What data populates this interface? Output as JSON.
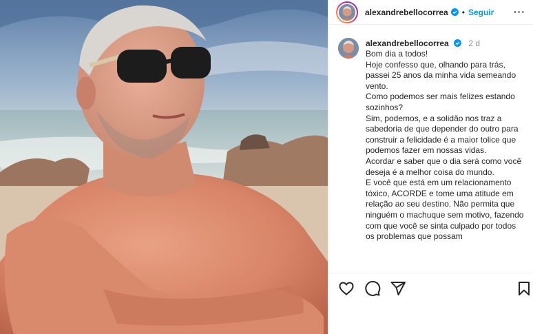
{
  "post": {
    "username": "alexandrebellocorrea",
    "follow_label": "Seguir",
    "separator": "•",
    "more_label": "···",
    "caption_username": "alexandrebellocorrea",
    "caption_time": "2 d",
    "caption_text": "Bom dia a todos!\nHoje confesso que, olhando para trás, passei 25 anos da minha vida semeando vento.\nComo podemos ser mais felizes estando sozinhos?\nSim, podemos, e a solidão nos traz a sabedoria de que depender do outro para construir a felicidade é a maior tolice que podemos fazer em nossas vidas.\nAcordar e saber que o dia será como você deseja é a melhor coisa do mundo.\nE você que está em um relacionamento tóxico, ACORDE e tome uma atitude em relação ao seu destino. Não permita que ninguém o machuque sem motivo, fazendo com que você se sinta culpado por todos os problemas que possam"
  },
  "icons": {
    "verified": "verified-badge-icon",
    "like": "heart-icon",
    "comment": "comment-icon",
    "share": "paper-plane-icon",
    "save": "bookmark-icon"
  },
  "colors": {
    "accent": "#0095f6",
    "text": "#262626",
    "muted": "#8e8e8e",
    "border": "#efefef"
  }
}
